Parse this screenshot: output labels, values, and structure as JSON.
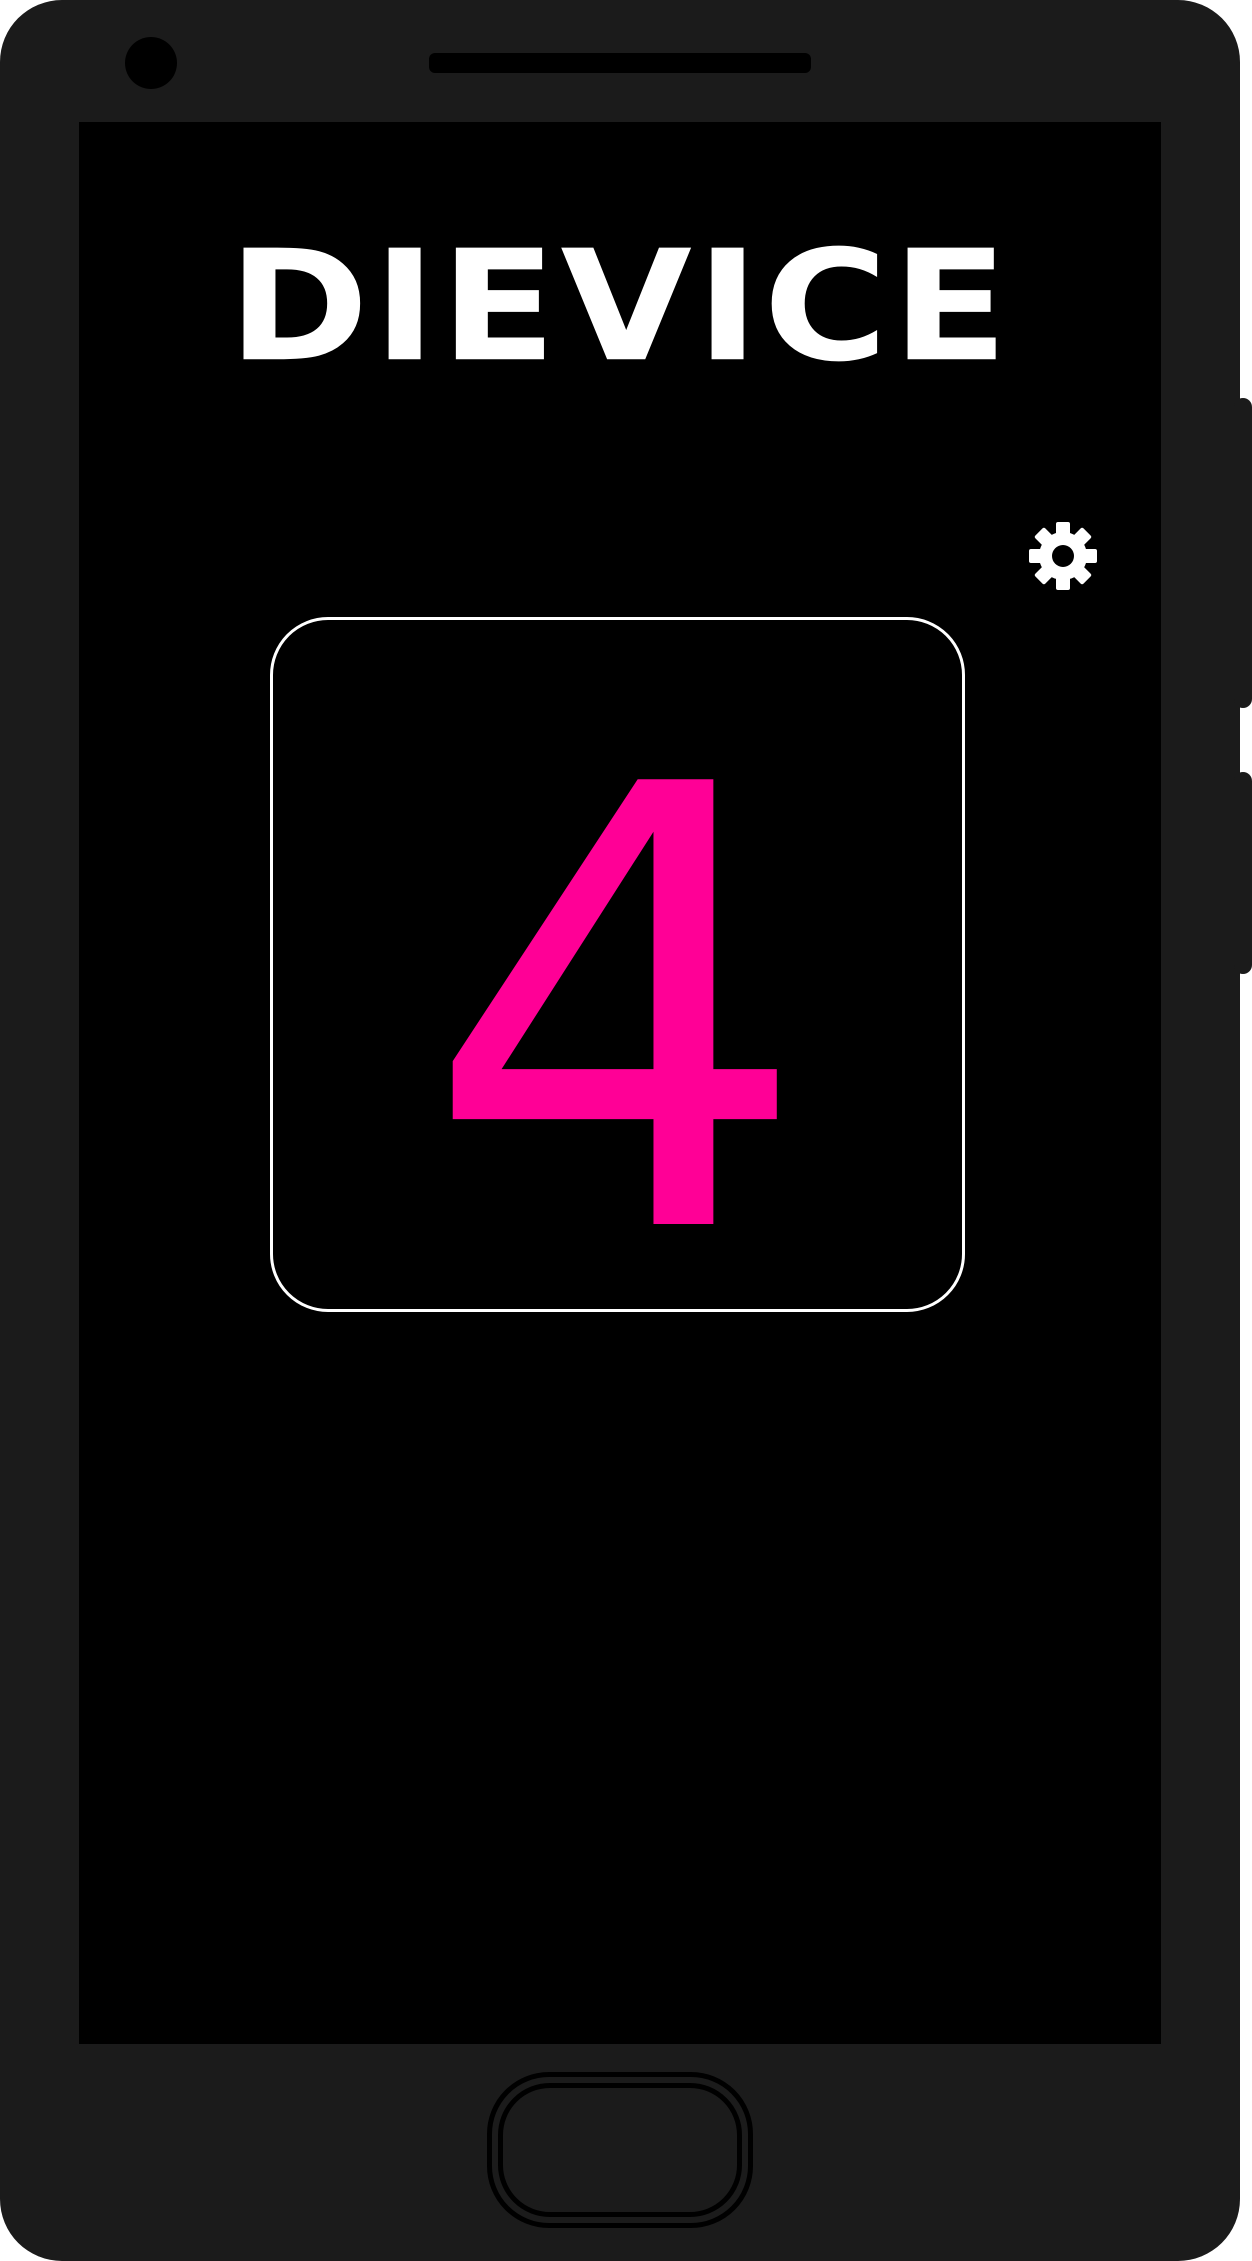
{
  "app": {
    "title": "DIEVICE",
    "current_number": "4"
  },
  "icons": {
    "settings": "gear-icon"
  },
  "colors": {
    "device_body": "#1b1b1b",
    "screen_background": "#000000",
    "title_text": "#ffffff",
    "number_accent": "#ff0096",
    "card_border": "#ffffff"
  }
}
